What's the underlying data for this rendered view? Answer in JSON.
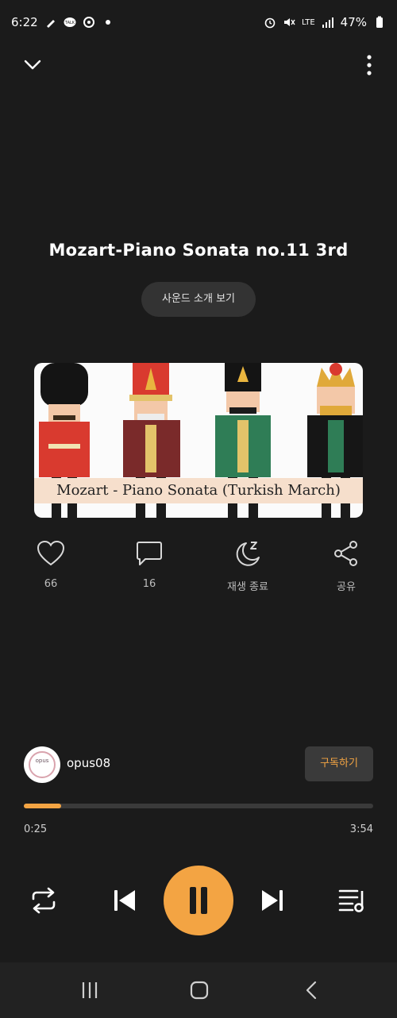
{
  "status_bar": {
    "time": "6:22",
    "network": "LTE",
    "battery": "47%",
    "icons": [
      "pen-icon",
      "talk-icon",
      "gear-icon",
      "dot-icon",
      "alarm-icon",
      "mute-icon",
      "signal-icon",
      "battery-icon"
    ]
  },
  "header": {
    "collapse_icon": "chevron-down-icon",
    "menu_icon": "more-vertical-icon"
  },
  "track": {
    "title": "Mozart-Piano Sonata no.11 3rd",
    "intro_button": "사운드 소개 보기",
    "artwork_caption": "Mozart - Piano Sonata (Turkish March)"
  },
  "actions": [
    {
      "icon": "heart-icon",
      "label": "66"
    },
    {
      "icon": "comment-icon",
      "label": "16"
    },
    {
      "icon": "sleep-timer-icon",
      "label": "재생 종료"
    },
    {
      "icon": "share-icon",
      "label": "공유"
    }
  ],
  "channel": {
    "name": "opus08",
    "avatar_text": "opus",
    "subscribe_label": "구독하기"
  },
  "player": {
    "elapsed": "0:25",
    "total": "3:54",
    "progress_fraction": 0.107,
    "accent_color": "#f3a443"
  },
  "controls": {
    "repeat_icon": "repeat-icon",
    "previous_icon": "skip-previous-icon",
    "pause_icon": "pause-icon",
    "next_icon": "skip-next-icon",
    "playlist_icon": "playlist-icon"
  },
  "system_nav": {
    "recents_icon": "recents-icon",
    "home_icon": "home-icon",
    "back_icon": "back-icon"
  }
}
